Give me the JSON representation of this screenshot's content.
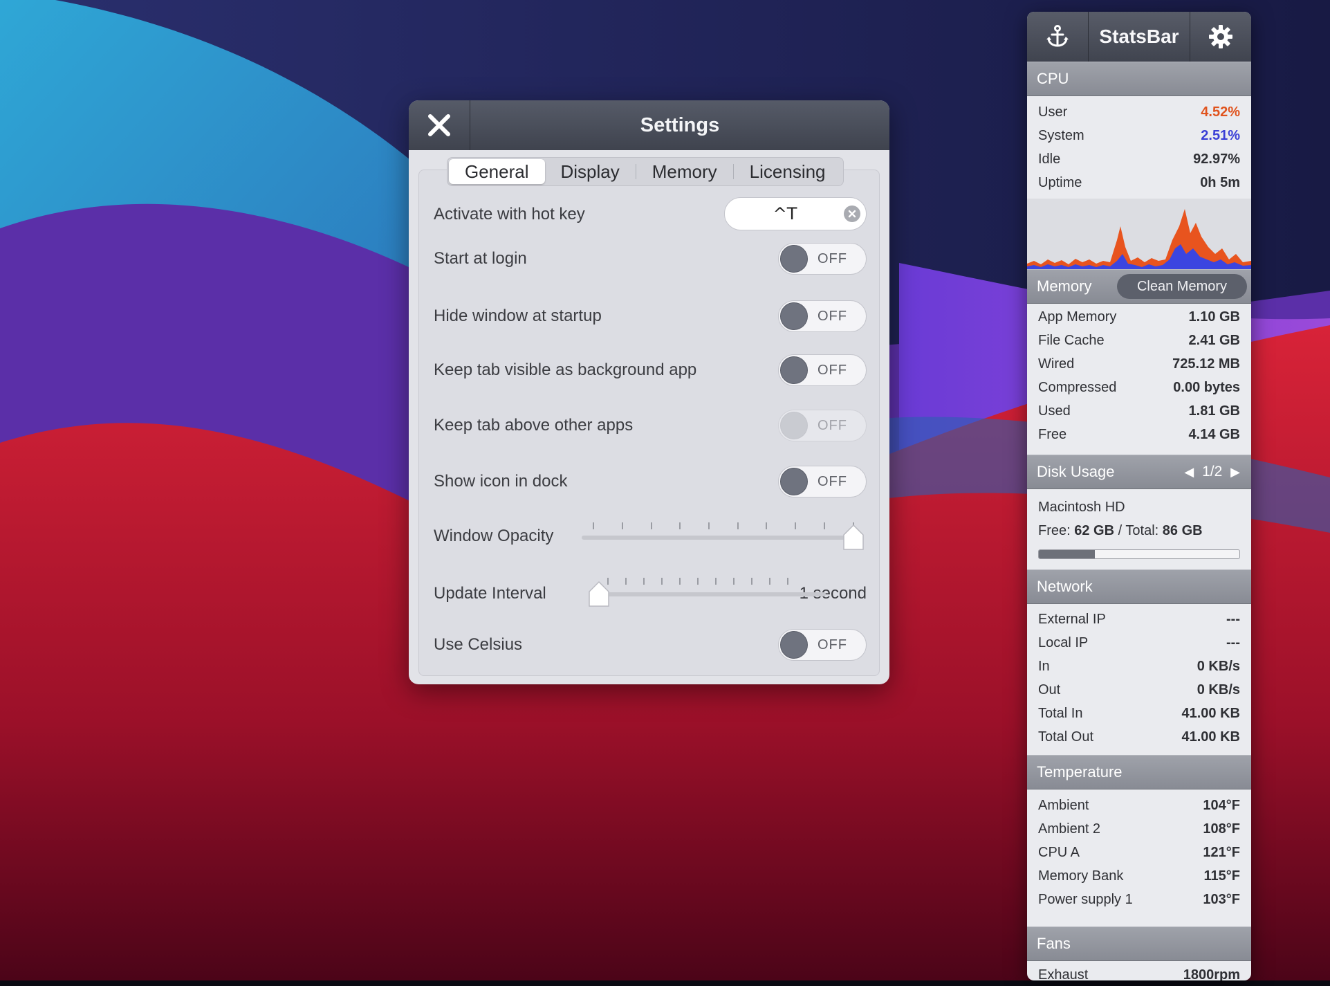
{
  "settings": {
    "title": "Settings",
    "tabs": [
      {
        "label": "General",
        "active": true
      },
      {
        "label": "Display",
        "active": false
      },
      {
        "label": "Memory",
        "active": false
      },
      {
        "label": "Licensing",
        "active": false
      }
    ],
    "hotkey": {
      "label": "Activate with hot key",
      "value": "^T"
    },
    "toggles": [
      {
        "label": "Start at login",
        "state": "OFF",
        "enabled": true
      },
      {
        "label": "Hide window at startup",
        "state": "OFF",
        "enabled": true
      },
      {
        "label": "Keep tab visible as background app",
        "state": "OFF",
        "enabled": true
      },
      {
        "label": "Keep tab above other apps",
        "state": "OFF",
        "enabled": false
      },
      {
        "label": "Show icon in dock",
        "state": "OFF",
        "enabled": true
      }
    ],
    "opacity": {
      "label": "Window Opacity",
      "value_fraction": 1.0
    },
    "interval": {
      "label": "Update Interval",
      "value_text": "1 second",
      "value_fraction": 0.0
    },
    "celsius": {
      "label": "Use Celsius",
      "state": "OFF"
    }
  },
  "statsbar": {
    "title": "StatsBar",
    "cpu": {
      "heading": "CPU",
      "rows": [
        {
          "key": "User",
          "value": "4.52%",
          "color": "#e0531d"
        },
        {
          "key": "System",
          "value": "2.51%",
          "color": "#3a3fd6"
        },
        {
          "key": "Idle",
          "value": "92.97%"
        },
        {
          "key": "Uptime",
          "value": "0h 5m"
        }
      ],
      "graph_colors": {
        "user": "#e8541e",
        "system": "#3b45e0"
      }
    },
    "memory": {
      "heading": "Memory",
      "clean_label": "Clean Memory",
      "rows": [
        {
          "key": "App Memory",
          "value": "1.10 GB"
        },
        {
          "key": "File Cache",
          "value": "2.41 GB"
        },
        {
          "key": "Wired",
          "value": "725.12 MB"
        },
        {
          "key": "Compressed",
          "value": "0.00 bytes"
        },
        {
          "key": "Used",
          "value": "1.81 GB"
        },
        {
          "key": "Free",
          "value": "4.14 GB"
        }
      ]
    },
    "disk": {
      "heading": "Disk Usage",
      "page": "1/2",
      "name": "Macintosh HD",
      "free_label": "Free:",
      "free_value": "62 GB",
      "separator": "/",
      "total_label": "Total:",
      "total_value": "86 GB",
      "used_fraction": 0.28
    },
    "network": {
      "heading": "Network",
      "rows": [
        {
          "key": "External IP",
          "value": "---"
        },
        {
          "key": "Local IP",
          "value": "---"
        },
        {
          "key": "In",
          "value": "0 KB/s"
        },
        {
          "key": "Out",
          "value": "0 KB/s"
        },
        {
          "key": "Total In",
          "value": "41.00 KB"
        },
        {
          "key": "Total Out",
          "value": "41.00 KB"
        }
      ]
    },
    "temperature": {
      "heading": "Temperature",
      "rows": [
        {
          "key": "Ambient",
          "value": "104°F"
        },
        {
          "key": "Ambient 2",
          "value": "108°F"
        },
        {
          "key": "CPU A",
          "value": "121°F"
        },
        {
          "key": "Memory Bank",
          "value": "115°F"
        },
        {
          "key": "Power supply 1",
          "value": "103°F"
        }
      ]
    },
    "fans": {
      "heading": "Fans",
      "rows": [
        {
          "key": "Exhaust",
          "value": "1800rpm"
        }
      ]
    }
  }
}
